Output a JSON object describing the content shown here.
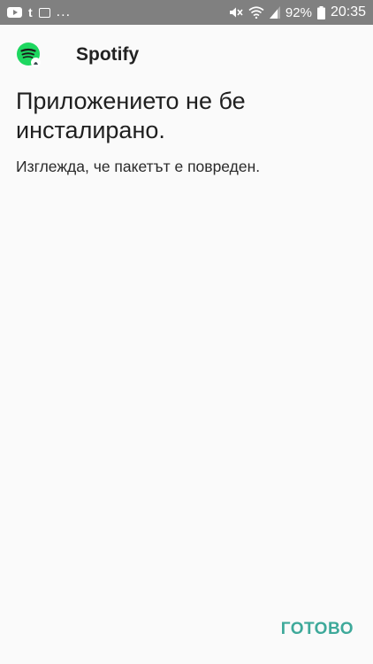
{
  "status_bar": {
    "overflow_indicator": "...",
    "battery_percent": "92%",
    "time": "20:35",
    "left_icons": [
      "youtube-icon",
      "tumblr-icon",
      "gallery-icon"
    ],
    "right_icons": [
      "mute-icon",
      "wifi-icon",
      "signal-icon",
      "battery-icon"
    ]
  },
  "dialog": {
    "app_icon": "spotify-icon",
    "app_name": "Spotify",
    "title": "Приложението не бе инсталирано.",
    "message": "Изглежда, че пакетът е повреден.",
    "done_label": "ГОТОВО"
  },
  "colors": {
    "status_bar_bg": "#808080",
    "background": "#fafafa",
    "accent": "#3ea99a",
    "spotify_green": "#1ed760"
  }
}
